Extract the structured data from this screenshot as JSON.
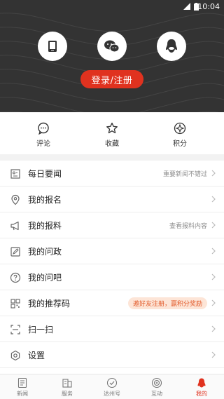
{
  "status": {
    "time": "10:04"
  },
  "header": {
    "login_button": "登录/注册",
    "icons": [
      "phone-icon",
      "wechat-icon",
      "qq-icon"
    ]
  },
  "quick_actions": [
    {
      "label": "评论",
      "icon": "comment-icon"
    },
    {
      "label": "收藏",
      "icon": "star-icon"
    },
    {
      "label": "积分",
      "icon": "points-icon"
    }
  ],
  "menu": [
    {
      "title": "每日要闻",
      "hint": "重要新闻不错过",
      "icon": "daily-news-icon"
    },
    {
      "title": "我的报名",
      "hint": "",
      "icon": "location-icon"
    },
    {
      "title": "我的报料",
      "hint": "查看报料内容",
      "icon": "megaphone-icon"
    },
    {
      "title": "我的问政",
      "hint": "",
      "icon": "edit-icon"
    },
    {
      "title": "我的问吧",
      "hint": "",
      "icon": "question-icon"
    },
    {
      "title": "我的推荐码",
      "badge": "邀好友注册，赢积分奖励",
      "icon": "qrcode-icon"
    },
    {
      "title": "扫一扫",
      "hint": "",
      "icon": "scan-icon"
    },
    {
      "title": "设置",
      "hint": "",
      "icon": "settings-icon"
    }
  ],
  "tabs": [
    {
      "label": "新闻",
      "icon": "news-icon"
    },
    {
      "label": "服务",
      "icon": "service-icon"
    },
    {
      "label": "达州号",
      "icon": "check-circle-icon"
    },
    {
      "label": "互动",
      "icon": "interaction-icon"
    },
    {
      "label": "我的",
      "icon": "profile-icon",
      "active": true
    }
  ],
  "colors": {
    "accent": "#e0321f",
    "header_bg": "#333333"
  }
}
